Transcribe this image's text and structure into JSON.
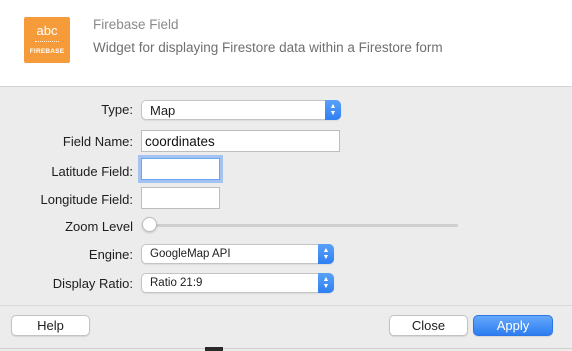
{
  "header": {
    "icon_text": "abc",
    "icon_brand": "FIREBASE",
    "title": "Firebase Field",
    "description": "Widget for displaying Firestore data within a Firestore form"
  },
  "form": {
    "type": {
      "label": "Type:",
      "value": "Map"
    },
    "field_name": {
      "label": "Field Name:",
      "value": "coordinates"
    },
    "latitude_field": {
      "label": "Latitude Field:",
      "value": ""
    },
    "longitude_field": {
      "label": "Longitude Field:",
      "value": ""
    },
    "zoom_level": {
      "label": "Zoom Level",
      "level": 0
    },
    "engine": {
      "label": "Engine:",
      "value": "GoogleMap API"
    },
    "display_ratio": {
      "label": "Display Ratio:",
      "value": "Ratio 21:9"
    }
  },
  "footer": {
    "help_label": "Help",
    "close_label": "Close",
    "apply_label": "Apply"
  },
  "colors": {
    "accent": "#2f7ff2",
    "icon_background": "#f59b3a"
  }
}
